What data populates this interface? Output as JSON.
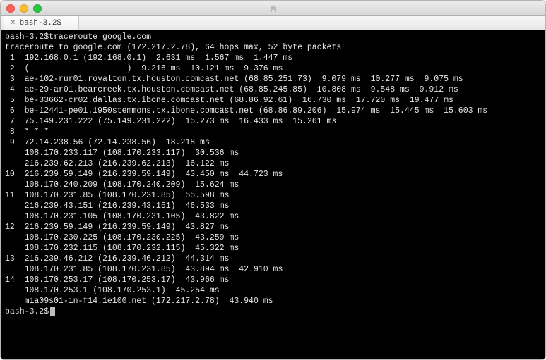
{
  "window": {
    "title_icon": "home-icon"
  },
  "tab": {
    "label": "bash-3.2$"
  },
  "prompt": {
    "text": "bash-3.2$",
    "command": "traceroute google.com"
  },
  "trace_header": "traceroute to google.com (172.217.2.78), 64 hops max, 52 byte packets",
  "blanked_hop2_host": "(                    )",
  "hops": [
    {
      "n": 1,
      "lines": [
        {
          "host": "192.168.0.1",
          "ip": "192.168.0.1",
          "rtts": [
            "2.631 ms",
            "1.567 ms",
            "1.447 ms"
          ]
        }
      ]
    },
    {
      "n": 2,
      "lines": [
        {
          "host_blanked": true,
          "rtts": [
            "9.216 ms",
            "10.121 ms",
            "9.376 ms"
          ]
        }
      ]
    },
    {
      "n": 3,
      "lines": [
        {
          "host": "ae-102-rur01.royalton.tx.houston.comcast.net",
          "ip": "68.85.251.73",
          "rtts": [
            "9.079 ms",
            "10.277 ms",
            "9.075 ms"
          ]
        }
      ]
    },
    {
      "n": 4,
      "lines": [
        {
          "host": "ae-29-ar01.bearcreek.tx.houston.comcast.net",
          "ip": "68.85.245.85",
          "rtts": [
            "10.808 ms",
            "9.548 ms",
            "9.912 ms"
          ]
        }
      ]
    },
    {
      "n": 5,
      "lines": [
        {
          "host": "be-33662-cr02.dallas.tx.ibone.comcast.net",
          "ip": "68.86.92.61",
          "rtts": [
            "16.730 ms",
            "17.720 ms",
            "19.477 ms"
          ]
        }
      ]
    },
    {
      "n": 6,
      "lines": [
        {
          "host": "be-12441-pe01.1950stemmons.tx.ibone.comcast.net",
          "ip": "68.86.89.206",
          "rtts": [
            "15.974 ms",
            "15.445 ms",
            "15.603 ms"
          ]
        }
      ]
    },
    {
      "n": 7,
      "lines": [
        {
          "host": "75.149.231.222",
          "ip": "75.149.231.222",
          "rtts": [
            "15.273 ms",
            "16.433 ms",
            "15.261 ms"
          ]
        }
      ]
    },
    {
      "n": 8,
      "lines": [
        {
          "timeout": "* * *"
        }
      ]
    },
    {
      "n": 9,
      "lines": [
        {
          "host": "72.14.238.56",
          "ip": "72.14.238.56",
          "rtts": [
            "18.218 ms"
          ]
        },
        {
          "host": "108.170.233.117",
          "ip": "108.170.233.117",
          "rtts": [
            "30.536 ms"
          ]
        },
        {
          "host": "216.239.62.213",
          "ip": "216.239.62.213",
          "rtts": [
            "16.122 ms"
          ]
        }
      ]
    },
    {
      "n": 10,
      "lines": [
        {
          "host": "216.239.59.149",
          "ip": "216.239.59.149",
          "rtts": [
            "43.450 ms",
            "44.723 ms"
          ]
        },
        {
          "host": "108.170.240.209",
          "ip": "108.170.240.209",
          "rtts": [
            "15.624 ms"
          ]
        }
      ]
    },
    {
      "n": 11,
      "lines": [
        {
          "host": "108.170.231.85",
          "ip": "108.170.231.85",
          "rtts": [
            "55.598 ms"
          ]
        },
        {
          "host": "216.239.43.151",
          "ip": "216.239.43.151",
          "rtts": [
            "46.533 ms"
          ]
        },
        {
          "host": "108.170.231.105",
          "ip": "108.170.231.105",
          "rtts": [
            "43.822 ms"
          ]
        }
      ]
    },
    {
      "n": 12,
      "lines": [
        {
          "host": "216.239.59.149",
          "ip": "216.239.59.149",
          "rtts": [
            "43.827 ms"
          ]
        },
        {
          "host": "108.170.230.225",
          "ip": "108.170.230.225",
          "rtts": [
            "43.259 ms"
          ]
        },
        {
          "host": "108.170.232.115",
          "ip": "108.170.232.115",
          "rtts": [
            "45.322 ms"
          ]
        }
      ]
    },
    {
      "n": 13,
      "lines": [
        {
          "host": "216.239.46.212",
          "ip": "216.239.46.212",
          "rtts": [
            "44.314 ms"
          ]
        },
        {
          "host": "108.170.231.85",
          "ip": "108.170.231.85",
          "rtts": [
            "43.894 ms",
            "42.910 ms"
          ]
        }
      ]
    },
    {
      "n": 14,
      "lines": [
        {
          "host": "108.170.253.17",
          "ip": "108.170.253.17",
          "rtts": [
            "43.966 ms"
          ]
        },
        {
          "host": "108.170.253.1",
          "ip": "108.170.253.1",
          "rtts": [
            "45.254 ms"
          ]
        },
        {
          "host": "mia09s01-in-f14.1e100.net",
          "ip": "172.217.2.78",
          "rtts": [
            "43.940 ms"
          ]
        }
      ]
    }
  ],
  "final_prompt": "bash-3.2$"
}
